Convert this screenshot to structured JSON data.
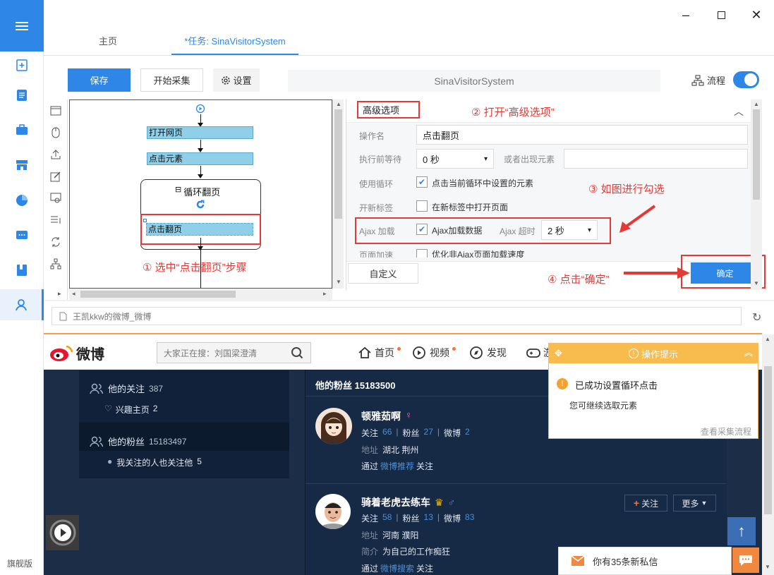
{
  "nav": {
    "edition": "旗舰版"
  },
  "tabs": {
    "home": "主页",
    "task": "*任务: SinaVisitorSystem"
  },
  "toolbar": {
    "save": "保存",
    "start": "开始采集",
    "settings": "设置",
    "task_name": "SinaVisitorSystem",
    "flow_label": "流程"
  },
  "flow": {
    "open_page": "打开网页",
    "click_element": "点击元素",
    "loop_label": "循环翻页",
    "click_next": "点击翻页",
    "loop_toggle_symbol": "⊟"
  },
  "options": {
    "section_title": "高级选项",
    "op_name_label": "操作名",
    "op_name_value": "点击翻页",
    "wait_label": "执行前等待",
    "wait_value": "0 秒",
    "or_appear_label": "或者出现元素",
    "loop_label": "使用循环",
    "loop_checkbox_label": "点击当前循环中设置的元素",
    "newtab_label": "开新标签",
    "newtab_checkbox_label": "在新标签中打开页面",
    "ajax_label": "Ajax 加载",
    "ajax_checkbox_label": "Ajax加载数据",
    "ajax_timeout_label": "Ajax 超时",
    "ajax_timeout_value": "2 秒",
    "speed_label": "页面加速",
    "speed_checkbox_label": "优化非Ajax页面加载速度",
    "custom_button": "自定义",
    "ok_button": "确定"
  },
  "annotations": {
    "step1": "① 选中“点击翻页”步骤",
    "step2": "② 打开“高级选项”",
    "step3": "③ 如图进行勾选",
    "step4": "④ 点击“确定”"
  },
  "browser": {
    "url": "王凯kkw的微博_微博"
  },
  "weibo": {
    "logo": "微博",
    "search_placeholder": "大家正在搜：刘国梁澄清",
    "nav": {
      "home": "首页",
      "video": "视频",
      "discover": "发现",
      "game": "游"
    },
    "side": {
      "following_label": "他的关注",
      "following_count": "387",
      "interest_label": "兴趣主页",
      "interest_count": "2",
      "fans_label": "他的粉丝",
      "fans_count": "15183497",
      "mutual_label": "我关注的人也关注他",
      "mutual_count": "5"
    },
    "list_title": "他的粉丝 15183500",
    "fans": [
      {
        "name": "顿雅茹啊",
        "gender": "♀",
        "follow_label": "关注",
        "follow": "66",
        "fans_label": "粉丝",
        "fans": "27",
        "weibo_label": "微博",
        "weibo": "2",
        "loc_label": "地址",
        "loc": "湖北 荆州",
        "via_pre": "通过",
        "via": "微博推荐",
        "via_post": "关注"
      },
      {
        "name": "骑着老虎去练车",
        "gender": "♂",
        "follow_label": "关注",
        "follow": "58",
        "fans_label": "粉丝",
        "fans": "13",
        "weibo_label": "微博",
        "weibo": "83",
        "loc_label": "地址",
        "loc": "河南 濮阳",
        "bio_label": "简介",
        "bio": "为自己的工作痴狂",
        "via_pre": "通过",
        "via": "微博搜索",
        "via_post": "关注",
        "btn_follow": "关注",
        "btn_more": "更多"
      }
    ],
    "message": "你有35条新私信"
  },
  "tip": {
    "title": "操作提示",
    "heading": "已成功设置循环点击",
    "body": "您可继续选取元素",
    "link": "查看采集流程"
  },
  "colors": {
    "accent": "#2e87e7",
    "annotation": "#e53935",
    "weibo_bg": "#1c2e47",
    "tip_header": "#f7bb4e"
  }
}
